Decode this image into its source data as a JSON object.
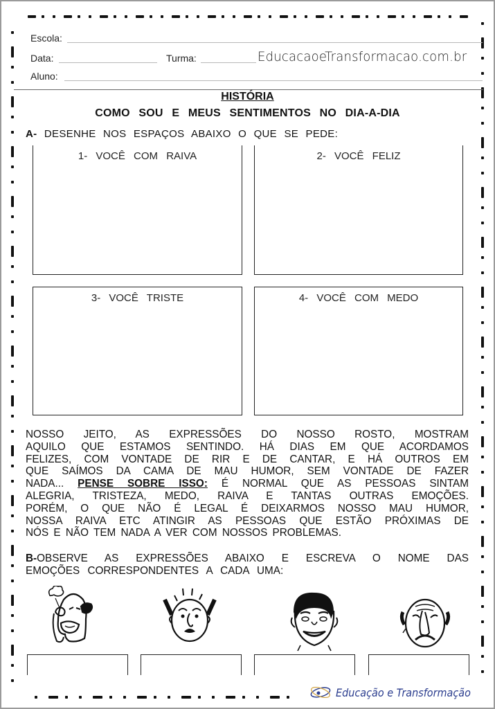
{
  "header": {
    "school_label": "Escola:",
    "date_label": "Data:",
    "class_label": "Turma:",
    "student_label": "Aluno:",
    "watermark_site": "EducacaoeTransformacao.com.br"
  },
  "titles": {
    "subject": "HISTÓRIA",
    "main": "COMO SOU E MEUS SENTIMENTOS NO DIA-A-DIA"
  },
  "section_a": {
    "marker": "A-",
    "instruction": "DESENHE NOS ESPAÇOS ABAIXO O QUE SE PEDE:",
    "boxes": [
      {
        "label": "1- VOCÊ COM RAIVA"
      },
      {
        "label": "2- VOCÊ FELIZ"
      },
      {
        "label": "3- VOCÊ TRISTE"
      },
      {
        "label": "4- VOCÊ COM MEDO"
      }
    ]
  },
  "paragraph": {
    "lines": [
      "NOSSO JEITO, AS EXPRESSÕES DO NOSSO ROSTO, MOSTRAM",
      "AQUILO QUE ESTAMOS SENTINDO. HÁ DIAS EM QUE ACORDAMOS",
      "FELIZES, COM VONTADE DE RIR E DE CANTAR, E HÁ OUTROS EM",
      "QUE SAÍMOS DA CAMA DE MAU HUMOR, SEM VONTADE DE FAZER"
    ],
    "line5_pre": "NADA...",
    "line5_emphasis": "PENSE SOBRE ISSO:",
    "line5_post": "É NORMAL QUE AS PESSOAS SINTAM",
    "lines_after": [
      "ALEGRIA, TRISTEZA, MEDO, RAIVA E TANTAS OUTRAS EMOÇÕES.",
      "PORÉM, O QUE NÃO É LEGAL É DEIXARMOS NOSSO MAU HUMOR,",
      "NOSSA RAIVA ETC ATINGIR AS PESSOAS QUE ESTÃO PRÓXIMAS DE",
      "NÓS E NÃO TEM NADA A VER COM NOSSOS PROBLEMAS."
    ]
  },
  "section_b": {
    "marker": "B-",
    "line1": "OBSERVE AS EXPRESSÕES ABAIXO E ESCREVA O NOME DAS",
    "line2": "EMOÇÕES CORRESPONDENTES A CADA UMA:",
    "faces": [
      {
        "icon": "angry-face-icon"
      },
      {
        "icon": "scared-face-icon"
      },
      {
        "icon": "happy-face-icon"
      },
      {
        "icon": "sad-face-icon"
      }
    ]
  },
  "footer": {
    "brand": "Educação e Transformação",
    "brand_color": "#2c3e8f"
  }
}
